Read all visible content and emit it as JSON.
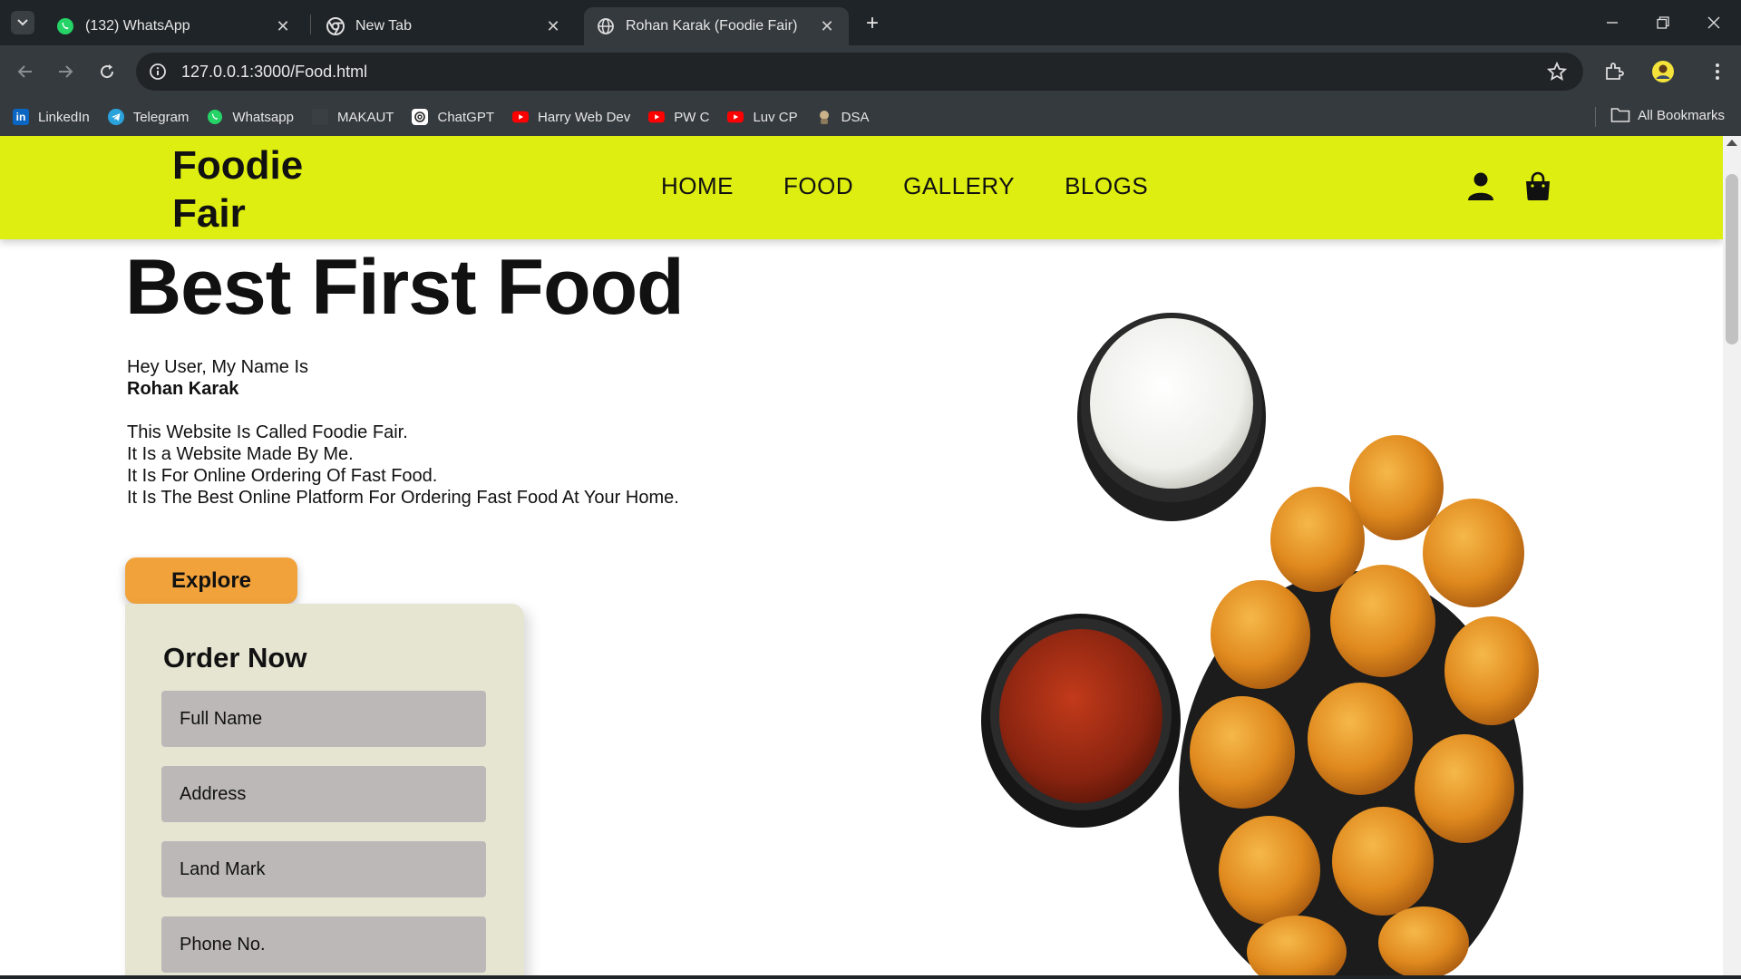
{
  "browser": {
    "tabs": [
      {
        "title": "(132) WhatsApp",
        "icon": "whatsapp-icon",
        "active": false
      },
      {
        "title": "New Tab",
        "icon": "chrome-icon",
        "active": false
      },
      {
        "title": "Rohan Karak (Foodie Fair)",
        "icon": "globe-icon",
        "active": true
      }
    ],
    "url": "127.0.0.1:3000/Food.html",
    "bookmarks": [
      {
        "label": "LinkedIn",
        "icon": "linkedin-icon",
        "color": "#0a66c2"
      },
      {
        "label": "Telegram",
        "icon": "telegram-icon",
        "color": "#2aa3dd"
      },
      {
        "label": "Whatsapp",
        "icon": "whatsapp-icon",
        "color": "#25d366"
      },
      {
        "label": "MAKAUT",
        "icon": "makaut-icon",
        "color": "#3a3f44"
      },
      {
        "label": "ChatGPT",
        "icon": "chatgpt-icon",
        "color": "#ffffff"
      },
      {
        "label": "Harry Web Dev",
        "icon": "youtube-icon",
        "color": "#ff0000"
      },
      {
        "label": "PW C",
        "icon": "youtube-icon",
        "color": "#ff0000"
      },
      {
        "label": "Luv CP",
        "icon": "youtube-icon",
        "color": "#ff0000"
      },
      {
        "label": "DSA",
        "icon": "dsa-icon",
        "color": "#c9b18a"
      }
    ],
    "all_bookmarks_label": "All Bookmarks"
  },
  "site": {
    "logo": "Foodie Fair",
    "menu": [
      "HOME",
      "FOOD",
      "GALLERY",
      "BLOGS"
    ],
    "accent_color": "#deee10"
  },
  "hero": {
    "title": "Best First Food",
    "greeting": "Hey User, My Name Is",
    "name": "Rohan Karak",
    "lines": [
      "This Website Is Called Foodie Fair.",
      "It Is a Website Made By Me.",
      "It Is For Online Ordering Of Fast Food.",
      "It Is The Best Online Platform For Ordering Fast Food At Your Home."
    ],
    "explore_label": "Explore",
    "button_color": "#f1a23b"
  },
  "order": {
    "title": "Order Now",
    "fields": [
      "Full Name",
      "Address",
      "Land Mark",
      "Phone No."
    ]
  }
}
